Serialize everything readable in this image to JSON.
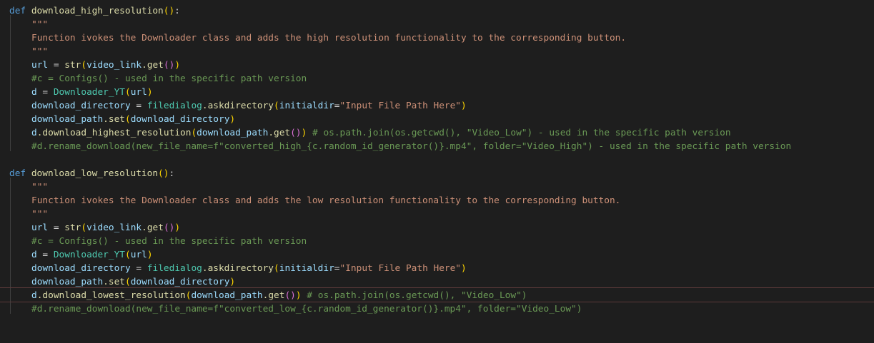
{
  "editor": {
    "func1": {
      "def_kw": "def",
      "name": "download_high_resolution",
      "docstring_open": "\"\"\"",
      "docstring_text": "Function ivokes the Downloader class and adds the high resolution functionality to the corresponding button.",
      "docstring_close": "\"\"\"",
      "line_url": {
        "var": "url",
        "eq": " = ",
        "builtin": "str",
        "arg": "video_link",
        "method": ".get",
        "close": "))"
      },
      "comment_configs": "#c = Configs() - used in the specific path version",
      "line_d": {
        "var": "d",
        "eq": " = ",
        "cls": "Downloader_YT",
        "arg": "url"
      },
      "line_dir": {
        "var": "download_directory",
        "eq": " = ",
        "mod": "filedialog",
        "method": ".askdirectory",
        "kw": "initialdir",
        "val": "\"Input File Path Here\""
      },
      "line_set": {
        "obj": "download_path",
        "method": ".set",
        "arg": "download_directory"
      },
      "line_call": {
        "obj": "d",
        "method": ".download_highest_resolution",
        "arg_obj": "download_path",
        "arg_method": ".get",
        "comment": "# os.path.join(os.getcwd(), \"Video_Low\") - used in the specific path version"
      },
      "comment_rename": "#d.rename_download(new_file_name=f\"converted_high_{c.random_id_generator()}.mp4\", folder=\"Video_High\") - used in the specific path version"
    },
    "func2": {
      "def_kw": "def",
      "name": "download_low_resolution",
      "docstring_open": "\"\"\"",
      "docstring_text": "Function ivokes the Downloader class and adds the low resolution functionality to the corresponding button.",
      "docstring_close": "\"\"\"",
      "line_url": {
        "var": "url",
        "eq": " = ",
        "builtin": "str",
        "arg": "video_link",
        "method": ".get",
        "close": "))"
      },
      "comment_configs": "#c = Configs() - used in the specific path version",
      "line_d": {
        "var": "d",
        "eq": " = ",
        "cls": "Downloader_YT",
        "arg": "url"
      },
      "line_dir": {
        "var": "download_directory",
        "eq": " = ",
        "mod": "filedialog",
        "method": ".askdirectory",
        "kw": "initialdir",
        "val": "\"Input File Path Here\""
      },
      "line_set": {
        "obj": "download_path",
        "method": ".set",
        "arg": "download_directory"
      },
      "line_call": {
        "obj": "d",
        "method": ".download_lowest_resolution",
        "arg_obj": "download_path",
        "arg_method": ".get",
        "comment": "# os.path.join(os.getcwd(), \"Video_Low\")"
      },
      "comment_rename": "#d.rename_download(new_file_name=f\"converted_low_{c.random_id_generator()}.mp4\", folder=\"Video_Low\")"
    }
  },
  "colors": {
    "background": "#1e1e1e",
    "keyword": "#569cd6",
    "function": "#dcdcaa",
    "string": "#ce9178",
    "comment": "#6a9955",
    "variable": "#9cdcfe",
    "class": "#4ec9b0"
  }
}
